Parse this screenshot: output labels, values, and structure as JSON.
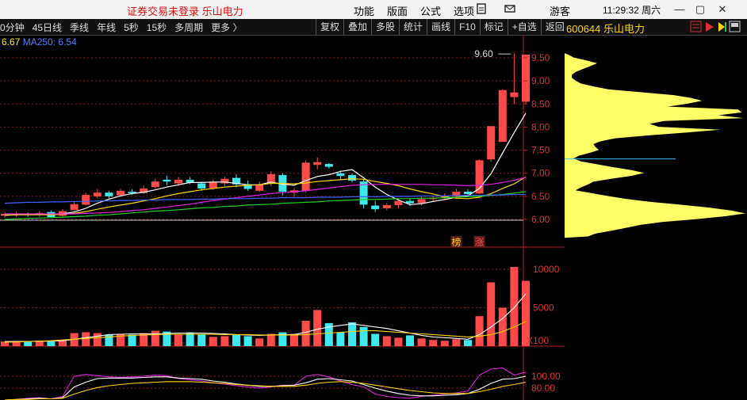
{
  "titlebar": {
    "title": "证券交易未登录  乐山电力",
    "menu": [
      "功能",
      "版面",
      "公式",
      "选项"
    ],
    "guest": "游客",
    "clock": "11:29:32 周六",
    "controls": [
      "—",
      "▢",
      "✕"
    ]
  },
  "toolbar": {
    "periods": [
      "0分钟",
      "45日线",
      "季线",
      "年线",
      "5秒",
      "15秒",
      "多周期",
      "更多 〉"
    ],
    "tools": [
      "复权",
      "叠加",
      "多股",
      "统计",
      "画线",
      "F10",
      "标记",
      "+自选",
      "返回"
    ],
    "stock": "600644 乐山电力"
  },
  "ma_labels": {
    "ma_a": "6.67",
    "ma250": "MA250: 6.54"
  },
  "colors": {
    "up": "#ff4a4a",
    "down": "#3ee8ee",
    "ma5": "#ffffff",
    "ma10": "#ffd400",
    "ma20": "#e020e0",
    "ma60": "#20d020",
    "ma250": "#4060ff",
    "profile": "#ffff66"
  },
  "main_chart": {
    "price_ticks": [
      "9.50",
      "9.00",
      "8.50",
      "8.00",
      "7.50",
      "7.00",
      "6.50",
      "6.00"
    ],
    "high_marker": "9.60",
    "tags": [
      "榜",
      "涨"
    ],
    "candles": [
      [
        6.08,
        6.12,
        6.04,
        6.16
      ],
      [
        6.1,
        6.12,
        6.06,
        6.16
      ],
      [
        6.12,
        6.1,
        6.06,
        6.15
      ],
      [
        6.1,
        6.14,
        6.06,
        6.18
      ],
      [
        6.16,
        6.05,
        6.03,
        6.19
      ],
      [
        6.08,
        6.18,
        6.06,
        6.22
      ],
      [
        6.2,
        6.33,
        6.18,
        6.4
      ],
      [
        6.32,
        6.53,
        6.3,
        6.58
      ],
      [
        6.5,
        6.58,
        6.46,
        6.66
      ],
      [
        6.58,
        6.5,
        6.45,
        6.62
      ],
      [
        6.52,
        6.62,
        6.49,
        6.66
      ],
      [
        6.6,
        6.57,
        6.53,
        6.65
      ],
      [
        6.57,
        6.67,
        6.55,
        6.74
      ],
      [
        6.7,
        6.82,
        6.66,
        6.88
      ],
      [
        6.86,
        6.82,
        6.74,
        6.95
      ],
      [
        6.78,
        6.86,
        6.72,
        6.92
      ],
      [
        6.86,
        6.8,
        6.76,
        6.92
      ],
      [
        6.78,
        6.67,
        6.62,
        6.82
      ],
      [
        6.68,
        6.8,
        6.64,
        6.86
      ],
      [
        6.78,
        6.88,
        6.72,
        6.93
      ],
      [
        6.9,
        6.76,
        6.7,
        6.98
      ],
      [
        6.76,
        6.66,
        6.62,
        6.84
      ],
      [
        6.62,
        6.76,
        6.6,
        6.82
      ],
      [
        6.78,
        6.98,
        6.72,
        7.04
      ],
      [
        6.96,
        6.6,
        6.52,
        7.0
      ],
      [
        6.58,
        6.63,
        6.5,
        6.68
      ],
      [
        6.62,
        7.23,
        6.58,
        7.28
      ],
      [
        7.18,
        7.24,
        7.08,
        7.34
      ],
      [
        7.2,
        7.14,
        7.1,
        7.22
      ],
      [
        7.0,
        6.94,
        6.86,
        7.06
      ],
      [
        6.96,
        6.84,
        6.8,
        7.0
      ],
      [
        6.82,
        6.32,
        6.24,
        6.86
      ],
      [
        6.3,
        6.22,
        6.16,
        6.4
      ],
      [
        6.24,
        6.31,
        6.2,
        6.36
      ],
      [
        6.31,
        6.4,
        6.24,
        6.44
      ],
      [
        6.4,
        6.35,
        6.29,
        6.46
      ],
      [
        6.35,
        6.44,
        6.3,
        6.49
      ],
      [
        6.44,
        6.47,
        6.38,
        6.5
      ],
      [
        6.47,
        6.5,
        6.44,
        6.56
      ],
      [
        6.5,
        6.6,
        6.45,
        6.66
      ],
      [
        6.6,
        6.55,
        6.5,
        6.65
      ],
      [
        6.56,
        7.28,
        6.55,
        7.3
      ],
      [
        7.3,
        8.02,
        7.25,
        8.02
      ],
      [
        7.68,
        8.8,
        7.68,
        8.82
      ],
      [
        8.65,
        8.75,
        8.5,
        9.6
      ],
      [
        8.55,
        9.57,
        8.5,
        9.57
      ]
    ],
    "ma5": [
      6.09,
      6.1,
      6.11,
      6.11,
      6.11,
      6.12,
      6.16,
      6.24,
      6.35,
      6.44,
      6.51,
      6.56,
      6.59,
      6.64,
      6.7,
      6.75,
      6.8,
      6.8,
      6.81,
      6.81,
      6.78,
      6.75,
      6.75,
      6.81,
      6.76,
      6.74,
      6.84,
      6.93,
      6.97,
      7.04,
      7.08,
      6.9,
      6.7,
      6.54,
      6.42,
      6.32,
      6.34,
      6.39,
      6.43,
      6.48,
      6.51,
      6.67,
      6.99,
      7.44,
      7.88,
      8.3
    ],
    "ma10": [
      6.1,
      6.1,
      6.1,
      6.1,
      6.1,
      6.11,
      6.13,
      6.17,
      6.22,
      6.27,
      6.31,
      6.35,
      6.4,
      6.45,
      6.51,
      6.56,
      6.6,
      6.64,
      6.67,
      6.7,
      6.72,
      6.74,
      6.75,
      6.78,
      6.78,
      6.77,
      6.79,
      6.82,
      6.84,
      6.86,
      6.88,
      6.87,
      6.82,
      6.78,
      6.73,
      6.66,
      6.6,
      6.55,
      6.49,
      6.46,
      6.45,
      6.48,
      6.56,
      6.67,
      6.77,
      6.92
    ],
    "ma20": [
      6.12,
      6.12,
      6.12,
      6.12,
      6.12,
      6.12,
      6.12,
      6.13,
      6.14,
      6.15,
      6.17,
      6.19,
      6.21,
      6.24,
      6.27,
      6.3,
      6.33,
      6.37,
      6.41,
      6.44,
      6.47,
      6.5,
      6.53,
      6.56,
      6.58,
      6.6,
      6.62,
      6.65,
      6.68,
      6.71,
      6.74,
      6.75,
      6.76,
      6.76,
      6.76,
      6.76,
      6.76,
      6.75,
      6.75,
      6.74,
      6.73,
      6.74,
      6.76,
      6.8,
      6.85,
      6.91
    ],
    "ma60": [
      6.0,
      6.01,
      6.02,
      6.03,
      6.04,
      6.05,
      6.06,
      6.07,
      6.09,
      6.1,
      6.12,
      6.14,
      6.16,
      6.18,
      6.19,
      6.21,
      6.23,
      6.25,
      6.26,
      6.28,
      6.29,
      6.31,
      6.32,
      6.33,
      6.35,
      6.36,
      6.37,
      6.38,
      6.4,
      6.41,
      6.42,
      6.43,
      6.43,
      6.44,
      6.45,
      6.45,
      6.46,
      6.46,
      6.47,
      6.48,
      6.49,
      6.5,
      6.52,
      6.54,
      6.57,
      6.6
    ],
    "ma250": [
      6.35,
      6.36,
      6.37,
      6.37,
      6.38,
      6.38,
      6.39,
      6.39,
      6.4,
      6.4,
      6.41,
      6.41,
      6.42,
      6.42,
      6.43,
      6.43,
      6.43,
      6.44,
      6.44,
      6.45,
      6.45,
      6.45,
      6.46,
      6.46,
      6.47,
      6.47,
      6.47,
      6.48,
      6.48,
      6.48,
      6.49,
      6.49,
      6.49,
      6.5,
      6.5,
      6.5,
      6.51,
      6.51,
      6.51,
      6.52,
      6.52,
      6.52,
      6.53,
      6.53,
      6.54,
      6.54
    ]
  },
  "volume_chart": {
    "ticks": [
      "10000",
      "5000"
    ],
    "unit": "X100",
    "values": [
      600,
      600,
      600,
      700,
      600,
      700,
      1700,
      1800,
      1700,
      1500,
      1600,
      1500,
      1700,
      2000,
      1900,
      1500,
      1800,
      1500,
      1200,
      1300,
      1500,
      1300,
      1000,
      1600,
      1800,
      1600,
      3300,
      4700,
      3000,
      1800,
      3100,
      2500,
      1600,
      1300,
      1100,
      1400,
      1000,
      800,
      700,
      900,
      800,
      3900,
      8300,
      5000,
      10300,
      8500
    ],
    "ma_a": [
      600,
      620,
      620,
      640,
      650,
      700,
      900,
      1100,
      1300,
      1500,
      1550,
      1600,
      1600,
      1600,
      1650,
      1700,
      1700,
      1700,
      1650,
      1600,
      1500,
      1450,
      1400,
      1450,
      1500,
      1500,
      1800,
      2200,
      2500,
      2700,
      2900,
      2700,
      2500,
      2300,
      2000,
      1700,
      1400,
      1200,
      1100,
      1000,
      900,
      1500,
      2500,
      3600,
      5000,
      6800
    ],
    "ma_b": [
      500,
      550,
      600,
      650,
      700,
      800,
      900,
      1000,
      1100,
      1200,
      1300,
      1400,
      1450,
      1500,
      1550,
      1550,
      1550,
      1550,
      1550,
      1500,
      1500,
      1500,
      1450,
      1450,
      1450,
      1450,
      1500,
      1600,
      1700,
      1800,
      1900,
      2000,
      2000,
      1900,
      1800,
      1700,
      1600,
      1500,
      1400,
      1300,
      1200,
      1300,
      1500,
      1900,
      2500,
      3200
    ]
  },
  "indicator_chart": {
    "ticks": [
      "100.00",
      "80.00"
    ],
    "line_a": [
      60,
      61,
      63,
      64,
      62,
      66,
      100,
      103,
      101,
      99,
      98,
      99,
      100,
      102,
      101,
      96,
      94,
      92,
      89,
      87,
      84,
      82,
      80,
      82,
      85,
      85,
      100,
      103,
      99,
      92,
      86,
      82,
      70,
      66,
      64,
      63,
      66,
      68,
      70,
      72,
      75,
      102,
      112,
      114,
      102,
      107
    ],
    "line_b": [
      60,
      61,
      62,
      63,
      62,
      64,
      82,
      90,
      96,
      97,
      97,
      97,
      98,
      99,
      99,
      97,
      96,
      95,
      92,
      90,
      87,
      85,
      83,
      83,
      84,
      85,
      89,
      95,
      96,
      94,
      92,
      86,
      80,
      75,
      71,
      68,
      67,
      67,
      68,
      69,
      71,
      78,
      88,
      95,
      96,
      100
    ],
    "line_c": [
      60,
      61,
      61,
      62,
      62,
      63,
      70,
      76,
      81,
      84,
      86,
      88,
      89,
      90,
      91,
      91,
      91,
      90,
      89,
      88,
      86,
      85,
      84,
      83,
      83,
      83,
      85,
      88,
      90,
      91,
      90,
      88,
      85,
      82,
      79,
      76,
      74,
      72,
      71,
      71,
      71,
      74,
      78,
      83,
      86,
      90
    ]
  },
  "chip_profile": {
    "ticks": [
      "9.50",
      "9.00",
      "8.50",
      "8.00",
      "7.50",
      "7.00",
      "6.50",
      "6.00"
    ],
    "avg_cost": 7.31,
    "price_lo": 5.6,
    "price_hi": 9.6,
    "widths": [
      0.02,
      0.05,
      0.12,
      0.18,
      0.14,
      0.1,
      0.06,
      0.04,
      0.04,
      0.06,
      0.09,
      0.16,
      0.24,
      0.42,
      0.6,
      0.7,
      0.76,
      0.68,
      0.57,
      0.96,
      0.98,
      0.85,
      0.99,
      0.55,
      0.47,
      0.52,
      0.86,
      0.67,
      0.46,
      0.28,
      0.2,
      0.16,
      0.17,
      0.19,
      0.14,
      0.08,
      0.05,
      0.09,
      0.18,
      0.27,
      0.37,
      0.44,
      0.37,
      0.26,
      0.16,
      0.13,
      0.09,
      0.06,
      0.15,
      0.24,
      0.34,
      0.47,
      0.64,
      0.8,
      0.92,
      1.0,
      0.89,
      0.73,
      0.54,
      0.42,
      0.34,
      0.26,
      0.17,
      0.13
    ]
  }
}
